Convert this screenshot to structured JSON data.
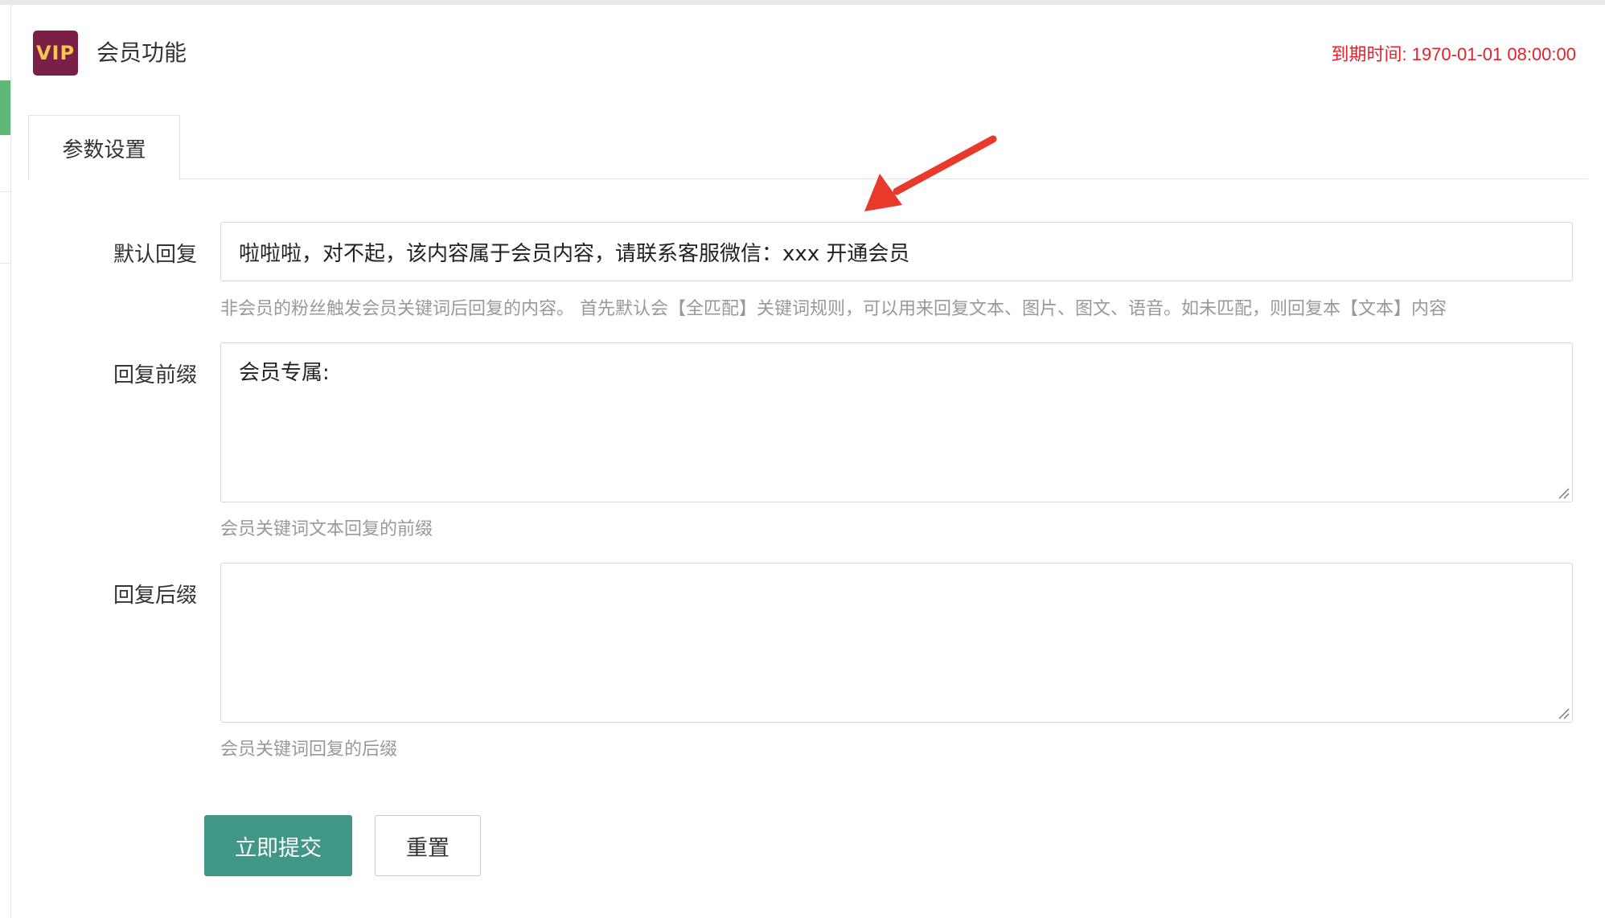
{
  "header": {
    "logo_text": "VIP",
    "title": "会员功能",
    "expiry_text": "到期时间: 1970-01-01 08:00:00"
  },
  "tabs": [
    {
      "label": "参数设置",
      "active": true
    }
  ],
  "form": {
    "default_reply": {
      "label": "默认回复",
      "value": "啦啦啦，对不起，该内容属于会员内容，请联系客服微信：xxx 开通会员",
      "hint": "非会员的粉丝触发会员关键词后回复的内容。 首先默认会【全匹配】关键词规则，可以用来回复文本、图片、图文、语音。如未匹配，则回复本【文本】内容"
    },
    "reply_prefix": {
      "label": "回复前缀",
      "value": "会员专属:",
      "hint": "会员关键词文本回复的前缀"
    },
    "reply_suffix": {
      "label": "回复后缀",
      "value": "",
      "hint": "会员关键词回复的后缀"
    }
  },
  "buttons": {
    "submit_label": "立即提交",
    "reset_label": "重置"
  },
  "colors": {
    "logo_bg": "#7a1f45",
    "logo_text": "#f2c94c",
    "expiry": "#e6212a",
    "submit_bg": "#419786",
    "sidebar_active": "#5fb878",
    "annotation_arrow": "#e8392b"
  }
}
